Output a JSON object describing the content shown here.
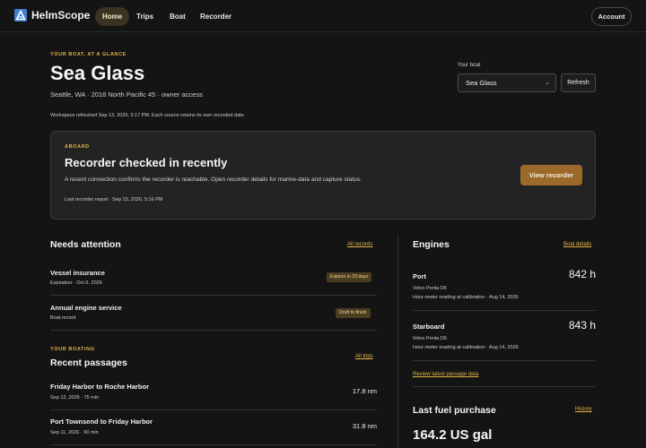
{
  "app": {
    "name": "HelmScope"
  },
  "nav": {
    "tabs": [
      {
        "label": "Home",
        "active": true
      },
      {
        "label": "Trips",
        "active": false
      },
      {
        "label": "Boat",
        "active": false
      },
      {
        "label": "Recorder",
        "active": false
      }
    ],
    "account_label": "Account"
  },
  "hero": {
    "eyebrow": "YOUR BOAT, AT A GLANCE",
    "boat_name": "Sea Glass",
    "meta": "Seattle, WA · 2018 North Pacific 45 · owner access",
    "refreshed": "Workspace refreshed Sep 13, 2026, 5:17 PM. Each source retains its own recorded date.",
    "boat_select_label": "Your boat",
    "boat_select_value": "Sea Glass",
    "refresh_label": "Refresh"
  },
  "aboard": {
    "eyebrow": "ABOARD",
    "title": "Recorder checked in recently",
    "description": "A recent connection confirms the recorder is reachable. Open recorder details for marine-data and capture status.",
    "report": "Last recorder report · Sep 13, 2026, 5:16 PM",
    "button_label": "View recorder"
  },
  "attention": {
    "title": "Needs attention",
    "link": "All records",
    "items": [
      {
        "title": "Vessel insurance",
        "sub": "Expiration · Oct 6, 2026",
        "badge": "Expires in 23 days"
      },
      {
        "title": "Annual engine service",
        "sub": "Boat record",
        "badge": "Draft to finish"
      }
    ]
  },
  "passages": {
    "eyebrow": "YOUR BOATING",
    "title": "Recent passages",
    "link": "All trips",
    "items": [
      {
        "title": "Friday Harbor to Roche Harbor",
        "sub": "Sep 12, 2026 · 75 min",
        "distance": "17.8 nm"
      },
      {
        "title": "Port Townsend to Friday Harbor",
        "sub": "Sep 11, 2026 · 90 min",
        "distance": "31.8 nm"
      }
    ]
  },
  "engines": {
    "title": "Engines",
    "link": "Boat details",
    "items": [
      {
        "name": "Port",
        "model": "Volvo Penta D6",
        "note": "Hour-meter reading at calibration · Aug 14, 2026",
        "hours": "842 h"
      },
      {
        "name": "Starboard",
        "model": "Volvo Penta D6",
        "note": "Hour-meter reading at calibration · Aug 14, 2026",
        "hours": "843 h"
      }
    ],
    "review_link": "Review latest passage data"
  },
  "fuel": {
    "title": "Last fuel purchase",
    "link": "History",
    "amount": "164.2 US gal"
  },
  "colors": {
    "accent": "#e3b447",
    "button": "#9b6a2a",
    "logo": "#3f7fd6"
  }
}
